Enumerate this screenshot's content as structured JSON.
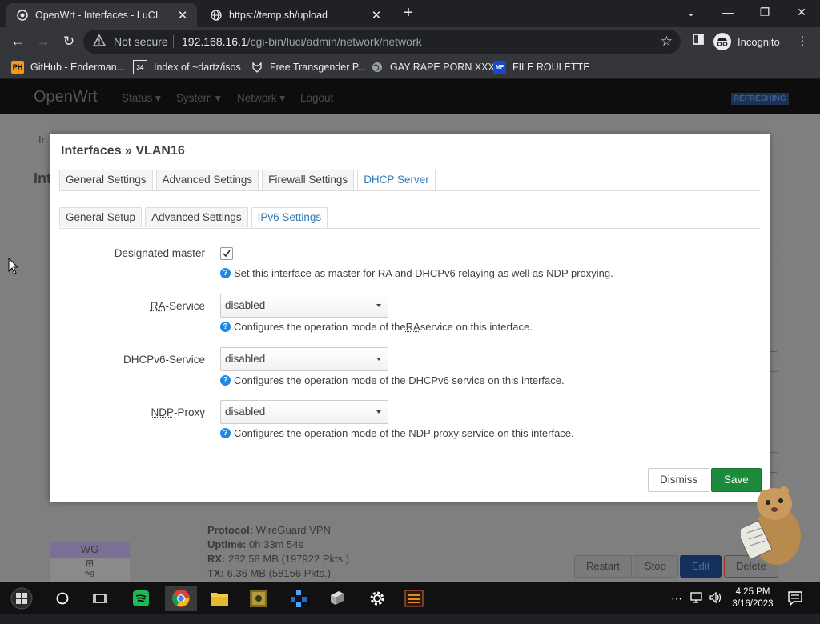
{
  "browser": {
    "tabs": [
      {
        "title": "OpenWrt - Interfaces - LuCI",
        "active": true
      },
      {
        "title": "https://temp.sh/upload",
        "active": false
      }
    ],
    "security_label": "Not secure",
    "url_host": "192.168.16.1",
    "url_path": "/cgi-bin/luci/admin/network/network",
    "profile_label": "Incognito",
    "bookmarks": [
      {
        "label": "GitHub - Enderman...",
        "icon": "PH"
      },
      {
        "label": "Index of ~dartz/isos",
        "icon": "34"
      },
      {
        "label": "Free Transgender P...",
        "icon": "fox"
      },
      {
        "label": "GAY RAPE PORN XXX",
        "icon": "globe"
      },
      {
        "label": "FILE ROULETTE",
        "icon": "MF"
      }
    ]
  },
  "luci": {
    "brand": "OpenWrt",
    "menu": [
      "Status",
      "System",
      "Network",
      "Logout"
    ],
    "status_badge": "REFRESHING",
    "background": {
      "crumb": "In",
      "heading": "Int",
      "protocol_label": "Protocol:",
      "protocol_value": "WireGuard VPN",
      "uptime_label": "Uptime:",
      "uptime_value": "0h 33m 54s",
      "rx_label": "RX:",
      "rx_value": "282.58 MB (197922 Pkts.)",
      "tx_label": "TX:",
      "tx_value": "6.36 MB (58156 Pkts.)",
      "iface_badge": "WG",
      "iface_sub": "wg",
      "buttons": [
        "Restart",
        "Stop",
        "Edit",
        "Delete"
      ]
    }
  },
  "modal": {
    "title": "Interfaces » VLAN16",
    "tabs": [
      "General Settings",
      "Advanced Settings",
      "Firewall Settings",
      "DHCP Server"
    ],
    "subtabs": [
      "General Setup",
      "Advanced Settings",
      "IPv6 Settings"
    ],
    "fields": {
      "designated_master": {
        "label": "Designated master",
        "checked": true,
        "help": "Set this interface as master for RA and DHCPv6 relaying as well as NDP proxying."
      },
      "ra_service": {
        "label_abbr": "RA",
        "label_rest": "-Service",
        "value": "disabled",
        "help_pre": "Configures the operation mode of the ",
        "help_abbr": "RA",
        "help_post": " service on this interface."
      },
      "dhcpv6_service": {
        "label": "DHCPv6-Service",
        "value": "disabled",
        "help": "Configures the operation mode of the DHCPv6 service on this interface."
      },
      "ndp_proxy": {
        "label_abbr": "NDP",
        "label_rest": "-Proxy",
        "value": "disabled",
        "help": "Configures the operation mode of the NDP proxy service on this interface."
      }
    },
    "dismiss_label": "Dismiss",
    "save_label": "Save"
  },
  "taskbar": {
    "time": "4:25 PM",
    "date": "3/16/2023"
  },
  "colors": {
    "accent": "#337ab7",
    "save": "#1b8a3b",
    "help_icon": "#1e88e5"
  }
}
